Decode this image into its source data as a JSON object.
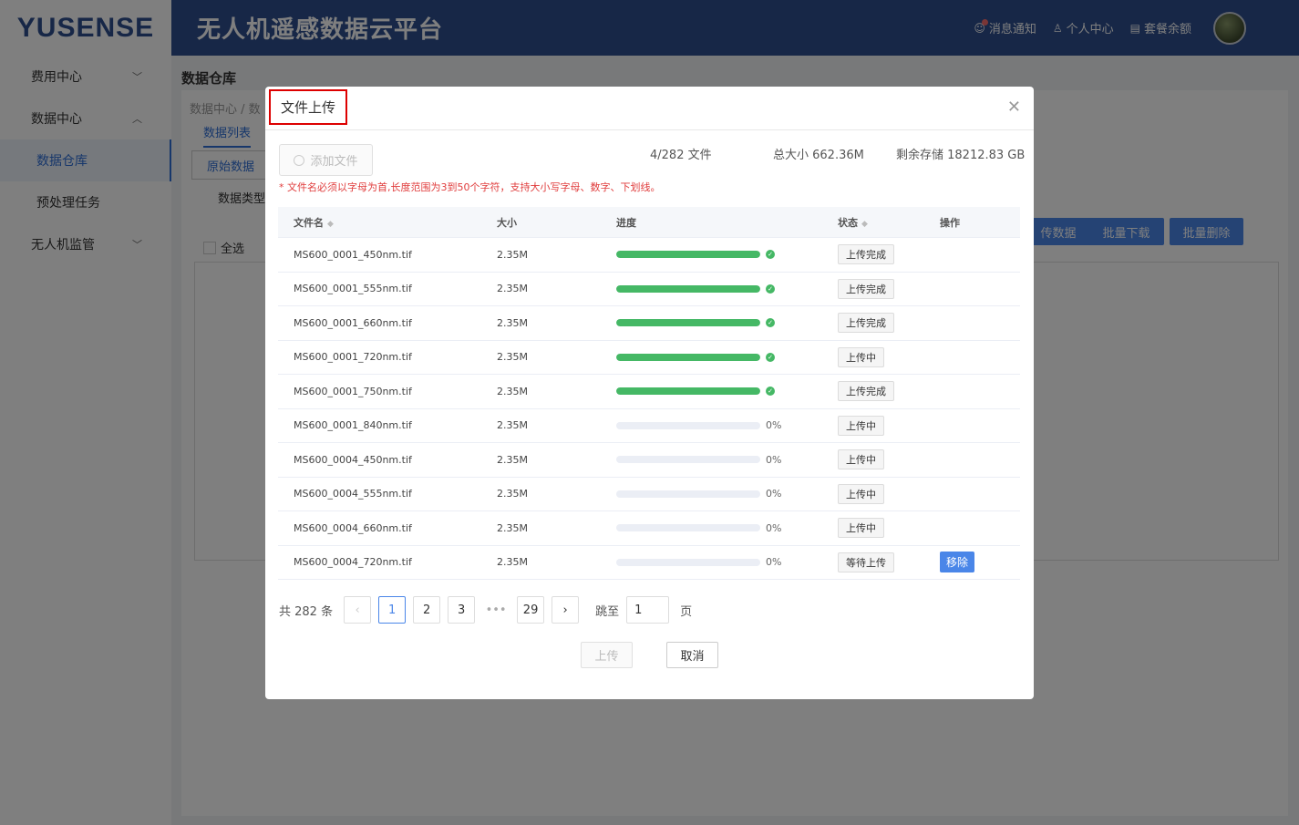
{
  "header": {
    "logo": "YUSENSE",
    "title": "无人机遥感数据云平台",
    "notify": "消息通知",
    "profile": "个人中心",
    "balance": "套餐余额"
  },
  "sidebar": {
    "items": [
      {
        "label": "费用中心"
      },
      {
        "label": "数据中心"
      },
      {
        "label": "数据仓库"
      },
      {
        "label": "预处理任务"
      },
      {
        "label": "无人机监管"
      }
    ]
  },
  "page": {
    "title": "数据仓库",
    "breadcrumb": "数据中心  /  数",
    "tab_list": "数据列表",
    "tab_raw": "原始数据",
    "data_type": "数据类型",
    "select_all": "全选",
    "btn_upload_data": "传数据",
    "btn_batch_download": "批量下载",
    "btn_batch_delete": "批量删除"
  },
  "dialog": {
    "title": "文件上传",
    "add_file": "添加文件",
    "file_count": "4/282 文件",
    "total_size": "总大小 662.36M",
    "remaining": "剩余存储 18212.83 GB",
    "warning": "* 文件名必须以字母为首,长度范围为3到50个字符，支持大小写字母、数字、下划线。",
    "columns": [
      "文件名",
      "大小",
      "进度",
      "状态",
      "操作"
    ],
    "rows": [
      {
        "name": "MS600_0001_450nm.tif",
        "size": "2.35M",
        "progress": 100,
        "pct": "",
        "status": "上传完成",
        "action": ""
      },
      {
        "name": "MS600_0001_555nm.tif",
        "size": "2.35M",
        "progress": 100,
        "pct": "",
        "status": "上传完成",
        "action": ""
      },
      {
        "name": "MS600_0001_660nm.tif",
        "size": "2.35M",
        "progress": 100,
        "pct": "",
        "status": "上传完成",
        "action": ""
      },
      {
        "name": "MS600_0001_720nm.tif",
        "size": "2.35M",
        "progress": 100,
        "pct": "",
        "status": "上传中",
        "action": ""
      },
      {
        "name": "MS600_0001_750nm.tif",
        "size": "2.35M",
        "progress": 100,
        "pct": "",
        "status": "上传完成",
        "action": ""
      },
      {
        "name": "MS600_0001_840nm.tif",
        "size": "2.35M",
        "progress": 0,
        "pct": "0%",
        "status": "上传中",
        "action": ""
      },
      {
        "name": "MS600_0004_450nm.tif",
        "size": "2.35M",
        "progress": 0,
        "pct": "0%",
        "status": "上传中",
        "action": ""
      },
      {
        "name": "MS600_0004_555nm.tif",
        "size": "2.35M",
        "progress": 0,
        "pct": "0%",
        "status": "上传中",
        "action": ""
      },
      {
        "name": "MS600_0004_660nm.tif",
        "size": "2.35M",
        "progress": 0,
        "pct": "0%",
        "status": "上传中",
        "action": ""
      },
      {
        "name": "MS600_0004_720nm.tif",
        "size": "2.35M",
        "progress": 0,
        "pct": "0%",
        "status": "等待上传",
        "action": "移除"
      }
    ],
    "pager": {
      "total": "共 282 条",
      "pages": [
        "1",
        "2",
        "3",
        "29"
      ],
      "jump_label": "跳至",
      "jump_value": "1",
      "page_suffix": "页"
    },
    "btn_upload": "上传",
    "btn_cancel": "取消"
  },
  "colors": {
    "header_bg": "#2f4f8f",
    "accent": "#4a86e8",
    "progress": "#45b865",
    "warning": "#e03c3c"
  }
}
